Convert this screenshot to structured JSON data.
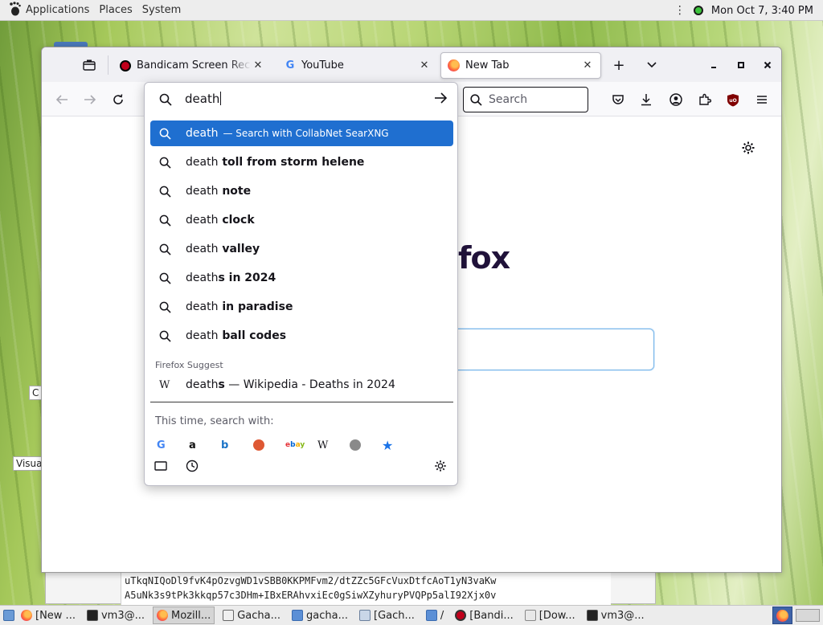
{
  "desktop": {
    "top_panel": {
      "menus": [
        "Applications",
        "Places",
        "System"
      ],
      "clock": "Mon Oct  7,  3:40 PM"
    },
    "background_window": {
      "text_lines": [
        "uTkqNIQoDl9fvK4pOzvgWD1vSBB0KKPMFvm2/dtZZc5GFcVuxDtfcAoT1yN3vaKw",
        "A5uNk3s9tPk3kkqp57c3DHm+IBxERAhvxiEc0gSiwXZyhuryPVQPp5alI92Xjx0v"
      ],
      "peek_labels": [
        "C",
        "Visua"
      ]
    },
    "taskbar": {
      "items": [
        {
          "label": "[New ...",
          "icon": "firefox-icon",
          "active": false
        },
        {
          "label": "vm3@...",
          "icon": "terminal-icon",
          "active": false
        },
        {
          "label": "Mozill...",
          "icon": "firefox-icon",
          "active": true
        },
        {
          "label": "Gacha...",
          "icon": "window-icon",
          "active": false
        },
        {
          "label": "gacha...",
          "icon": "folder-icon",
          "active": false
        },
        {
          "label": "[Gach...",
          "icon": "editor-icon",
          "active": false
        },
        {
          "label": "/",
          "icon": "folder-icon",
          "active": false
        },
        {
          "label": "[Bandi...",
          "icon": "bandicam-icon",
          "active": false
        },
        {
          "label": "[Dow...",
          "icon": "download-icon",
          "active": false
        },
        {
          "label": "vm3@...",
          "icon": "terminal-icon",
          "active": false
        }
      ]
    }
  },
  "browser": {
    "tabs": [
      {
        "title": "Bandicam Screen Recorder",
        "favicon": "bandicam-record-icon",
        "selected": false
      },
      {
        "title": "YouTube",
        "favicon": "google-icon",
        "selected": false
      },
      {
        "title": "New Tab",
        "favicon": "firefox-icon",
        "selected": true
      }
    ],
    "navbar": {
      "search_placeholder": "Search"
    },
    "new_tab_page": {
      "brand_fragment": "fox"
    },
    "urlbar": {
      "typed_text": "death",
      "results": [
        {
          "prefix": "death",
          "suffix": "",
          "note": "— Search with CollabNet SearXNG",
          "selected": true
        },
        {
          "prefix": "death",
          "suffix": " toll from storm helene",
          "note": "",
          "selected": false
        },
        {
          "prefix": "death",
          "suffix": " note",
          "note": "",
          "selected": false
        },
        {
          "prefix": "death",
          "suffix": " clock",
          "note": "",
          "selected": false
        },
        {
          "prefix": "death",
          "suffix": " valley",
          "note": "",
          "selected": false
        },
        {
          "prefix": "death",
          "suffix": "s in 2024",
          "note": "",
          "selected": false
        },
        {
          "prefix": "death",
          "suffix": " in paradise",
          "note": "",
          "selected": false
        },
        {
          "prefix": "death",
          "suffix": " ball codes",
          "note": "",
          "selected": false
        }
      ],
      "suggest_group_label": "Firefox Suggest",
      "wikipedia_result": {
        "prefix": "death",
        "bold": "s",
        "rest": " — Wikipedia - Deaths in 2024"
      },
      "one_off_label": "This time, search with:",
      "engines": [
        {
          "name": "Google",
          "icon": "google-icon"
        },
        {
          "name": "Amazon",
          "icon": "amazon-icon"
        },
        {
          "name": "Bing",
          "icon": "bing-icon"
        },
        {
          "name": "DuckDuckGo",
          "icon": "duckduckgo-icon"
        },
        {
          "name": "eBay",
          "icon": "ebay-icon"
        },
        {
          "name": "Wikipedia",
          "icon": "wikipedia-icon"
        },
        {
          "name": "SearXNG",
          "icon": "searxng-icon"
        },
        {
          "name": "Bookmarks",
          "icon": "star-icon"
        }
      ]
    }
  }
}
